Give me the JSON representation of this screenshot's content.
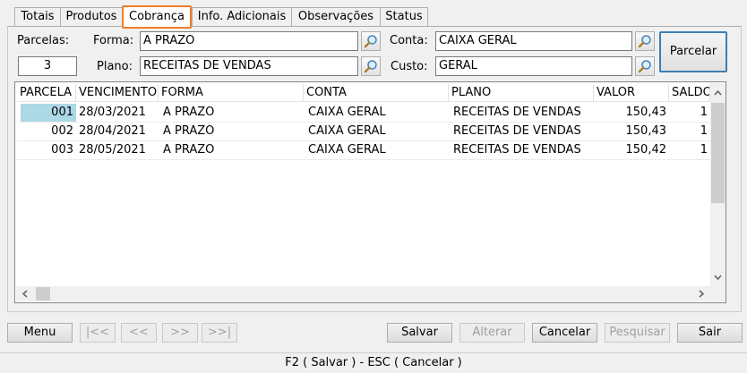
{
  "tabs": [
    {
      "label": "Totais"
    },
    {
      "label": "Produtos"
    },
    {
      "label": "Cobrança"
    },
    {
      "label": "Info. Adicionais"
    },
    {
      "label": "Observações"
    },
    {
      "label": "Status"
    }
  ],
  "active_tab": "Cobrança",
  "form": {
    "parcelas_label": "Parcelas:",
    "parcelas_value": "3",
    "forma_label": "Forma:",
    "forma_value": "A PRAZO",
    "plano_label": "Plano:",
    "plano_value": "RECEITAS DE VENDAS",
    "conta_label": "Conta:",
    "conta_value": "CAIXA GERAL",
    "custo_label": "Custo:",
    "custo_value": "GERAL",
    "parcelar_label": "Parcelar"
  },
  "grid": {
    "columns": [
      "PARCELA",
      "VENCIMENTO",
      "FORMA",
      "CONTA",
      "PLANO",
      "VALOR",
      "SALDO"
    ],
    "rows": [
      {
        "parcela": "001",
        "vencimento": "28/03/2021",
        "forma": "A PRAZO",
        "conta": "CAIXA GERAL",
        "plano": "RECEITAS DE VENDAS",
        "valor": "150,43",
        "saldo": "1"
      },
      {
        "parcela": "002",
        "vencimento": "28/04/2021",
        "forma": "A PRAZO",
        "conta": "CAIXA GERAL",
        "plano": "RECEITAS DE VENDAS",
        "valor": "150,43",
        "saldo": "1"
      },
      {
        "parcela": "003",
        "vencimento": "28/05/2021",
        "forma": "A PRAZO",
        "conta": "CAIXA GERAL",
        "plano": "RECEITAS DE VENDAS",
        "valor": "150,42",
        "saldo": "1"
      }
    ]
  },
  "toolbar": {
    "menu": "Menu",
    "first": "|<<",
    "prev": "<<",
    "next": ">>",
    "last": ">>|",
    "salvar": "Salvar",
    "alterar": "Alterar",
    "cancelar": "Cancelar",
    "pesquisar": "Pesquisar",
    "sair": "Sair"
  },
  "status_bar": "F2 ( Salvar )   -   ESC ( Cancelar )",
  "colors": {
    "active_tab_border": "#f07c2a",
    "selected_cell": "#add8e6",
    "default_button_border": "#3c7fb1"
  }
}
